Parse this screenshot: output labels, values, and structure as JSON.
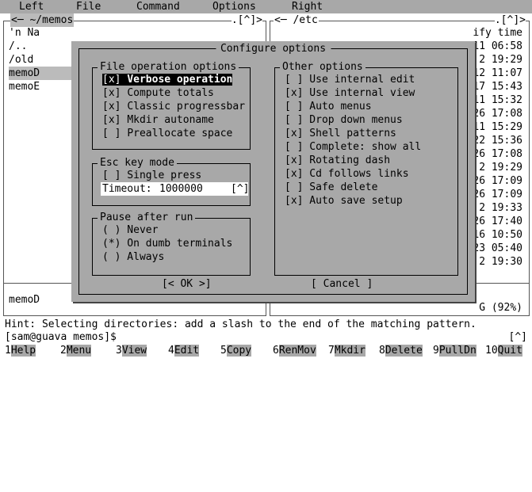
{
  "menubar": {
    "left": "Left",
    "file": "File",
    "command": "Command",
    "options": "Options",
    "right": "Right"
  },
  "left_panel": {
    "title": "~/memos",
    "corner": ".[^]>",
    "col_header": "'n    Na",
    "rows": [
      "/..",
      "/old",
      "memoD",
      "memoE"
    ],
    "footer": "memoD"
  },
  "right_panel": {
    "title": "/etc",
    "corner": ".[^]>",
    "col_header": "ify time",
    "times": [
      "11 06:58",
      " 2 19:29",
      "12 11:07",
      "17 15:43",
      "11 15:32",
      "26 17:08",
      "11 15:29",
      "22 15:36",
      "26 17:08",
      " 2 19:29",
      "26 17:09",
      "26 17:09",
      " 2 19:33",
      "26 17:40",
      "16 10:50",
      "23 05:40",
      " 2 19:30"
    ],
    "footer": "G (92%)"
  },
  "dialog": {
    "title": "Configure options",
    "file_ops": {
      "title": "File operation options",
      "items": [
        {
          "mark": "[x]",
          "label": "Verbose operation"
        },
        {
          "mark": "[x]",
          "label": "Compute totals"
        },
        {
          "mark": "[x]",
          "label": "Classic progressbar"
        },
        {
          "mark": "[x]",
          "label": "Mkdir autoname"
        },
        {
          "mark": "[ ]",
          "label": "Preallocate space"
        }
      ]
    },
    "esc": {
      "title": "Esc key mode",
      "single": "[ ] Single press",
      "timeout_label": "Timeout:",
      "timeout_value": "1000000",
      "timeout_hist": "[^]"
    },
    "pause": {
      "title": "Pause after run",
      "items": [
        "( ) Never",
        "(*) On dumb terminals",
        "( ) Always"
      ]
    },
    "other": {
      "title": "Other options",
      "items": [
        "[ ] Use internal edit",
        "[x] Use internal view",
        "[ ] Auto menus",
        "[ ] Drop down menus",
        "[x] Shell patterns",
        "[ ] Complete: show all",
        "[x] Rotating dash",
        "[x] Cd follows links",
        "[ ] Safe delete",
        "[x] Auto save setup"
      ]
    },
    "ok": "[< OK >]",
    "cancel": "[ Cancel ]"
  },
  "hint": "Hint: Selecting directories: add a slash to the end of the matching pattern.",
  "prompt": "[sam@guava memos]$",
  "prompt_corner": "[^]",
  "fkeys": [
    {
      "n": "1",
      "l": "Help"
    },
    {
      "n": "2",
      "l": "Menu"
    },
    {
      "n": "3",
      "l": "View"
    },
    {
      "n": "4",
      "l": "Edit"
    },
    {
      "n": "5",
      "l": "Copy"
    },
    {
      "n": "6",
      "l": "RenMov"
    },
    {
      "n": "7",
      "l": "Mkdir"
    },
    {
      "n": "8",
      "l": "Delete"
    },
    {
      "n": "9",
      "l": "PullDn"
    },
    {
      "n": "10",
      "l": "Quit"
    }
  ]
}
